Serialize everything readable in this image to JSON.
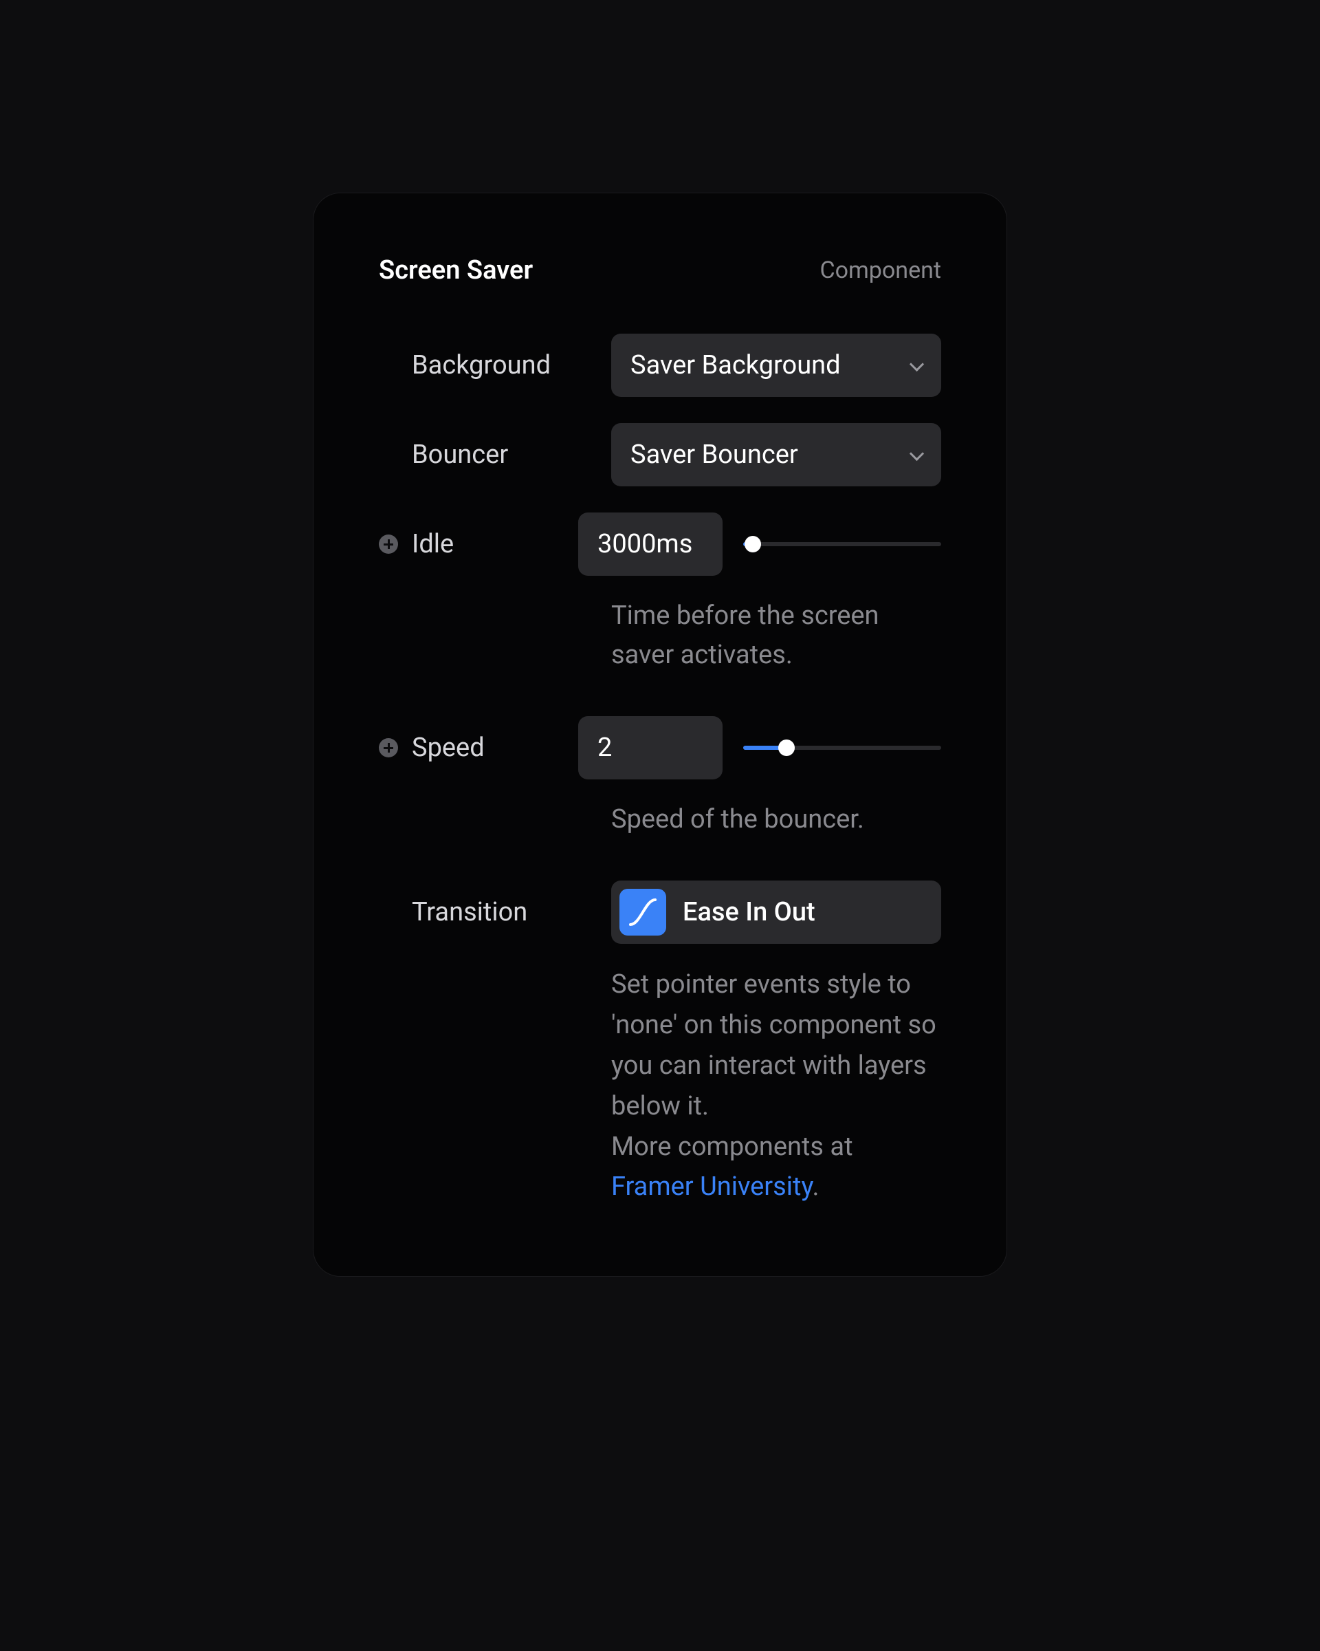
{
  "header": {
    "title": "Screen Saver",
    "subtitle": "Component"
  },
  "fields": {
    "background": {
      "label": "Background",
      "value": "Saver Background"
    },
    "bouncer": {
      "label": "Bouncer",
      "value": "Saver Bouncer"
    },
    "idle": {
      "label": "Idle",
      "value": "3000ms",
      "help": "Time before the screen saver activates.",
      "slider_percent": 5
    },
    "speed": {
      "label": "Speed",
      "value": "2",
      "help": "Speed of the bouncer.",
      "slider_percent": 22
    },
    "transition": {
      "label": "Transition",
      "value": "Ease In Out",
      "help_prefix": "Set pointer events style to 'none' on this component so you can interact with layers below it.",
      "help_more": "More components at ",
      "link_text": "Framer University",
      "help_suffix": "."
    }
  }
}
